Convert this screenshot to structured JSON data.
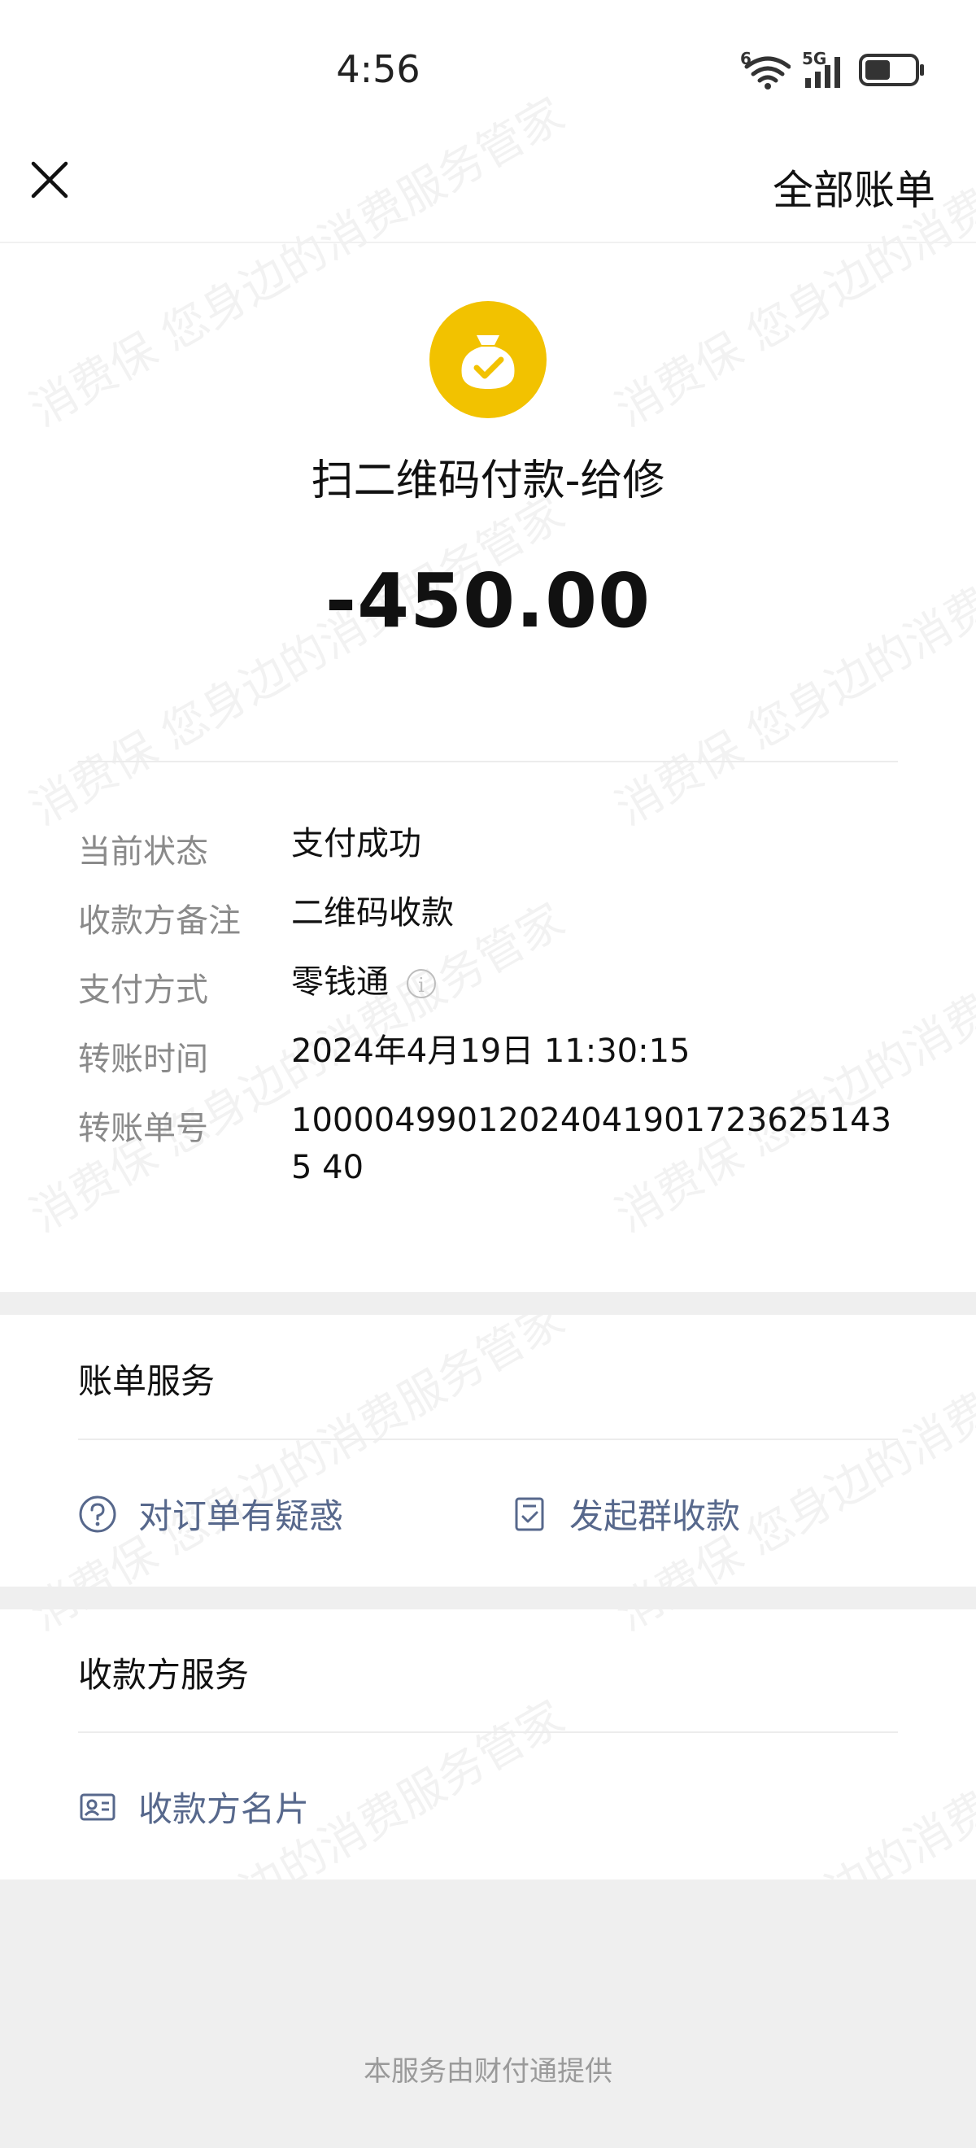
{
  "status_bar": {
    "time": "4:56",
    "wifi_badge": "6",
    "signal_badge": "5G"
  },
  "header": {
    "close_icon": "close-icon",
    "all_bills_label": "全部账单"
  },
  "transaction": {
    "merchant_name": "扫二维码付款-给修",
    "amount": "-450.00",
    "icon_color": "#f2c200"
  },
  "details": [
    {
      "label": "当前状态",
      "value": "支付成功"
    },
    {
      "label": "收款方备注",
      "value": "二维码收款"
    },
    {
      "label": "支付方式",
      "value": "零钱通"
    },
    {
      "label": "转账时间",
      "value": "2024年4月19日 11:30:15"
    },
    {
      "label": "转账单号",
      "value": "100004990120240419017236251435 40"
    }
  ],
  "bill_service": {
    "title": "账单服务",
    "doubt_label": "对订单有疑惑",
    "group_collect_label": "发起群收款"
  },
  "payee_service": {
    "title": "收款方服务",
    "card_label": "收款方名片"
  },
  "footer": {
    "text": "本服务由财付通提供"
  },
  "watermark_text": "消费保 您身边的消费服务管家",
  "colors": {
    "link": "#57688c",
    "accent": "#f2c200"
  }
}
